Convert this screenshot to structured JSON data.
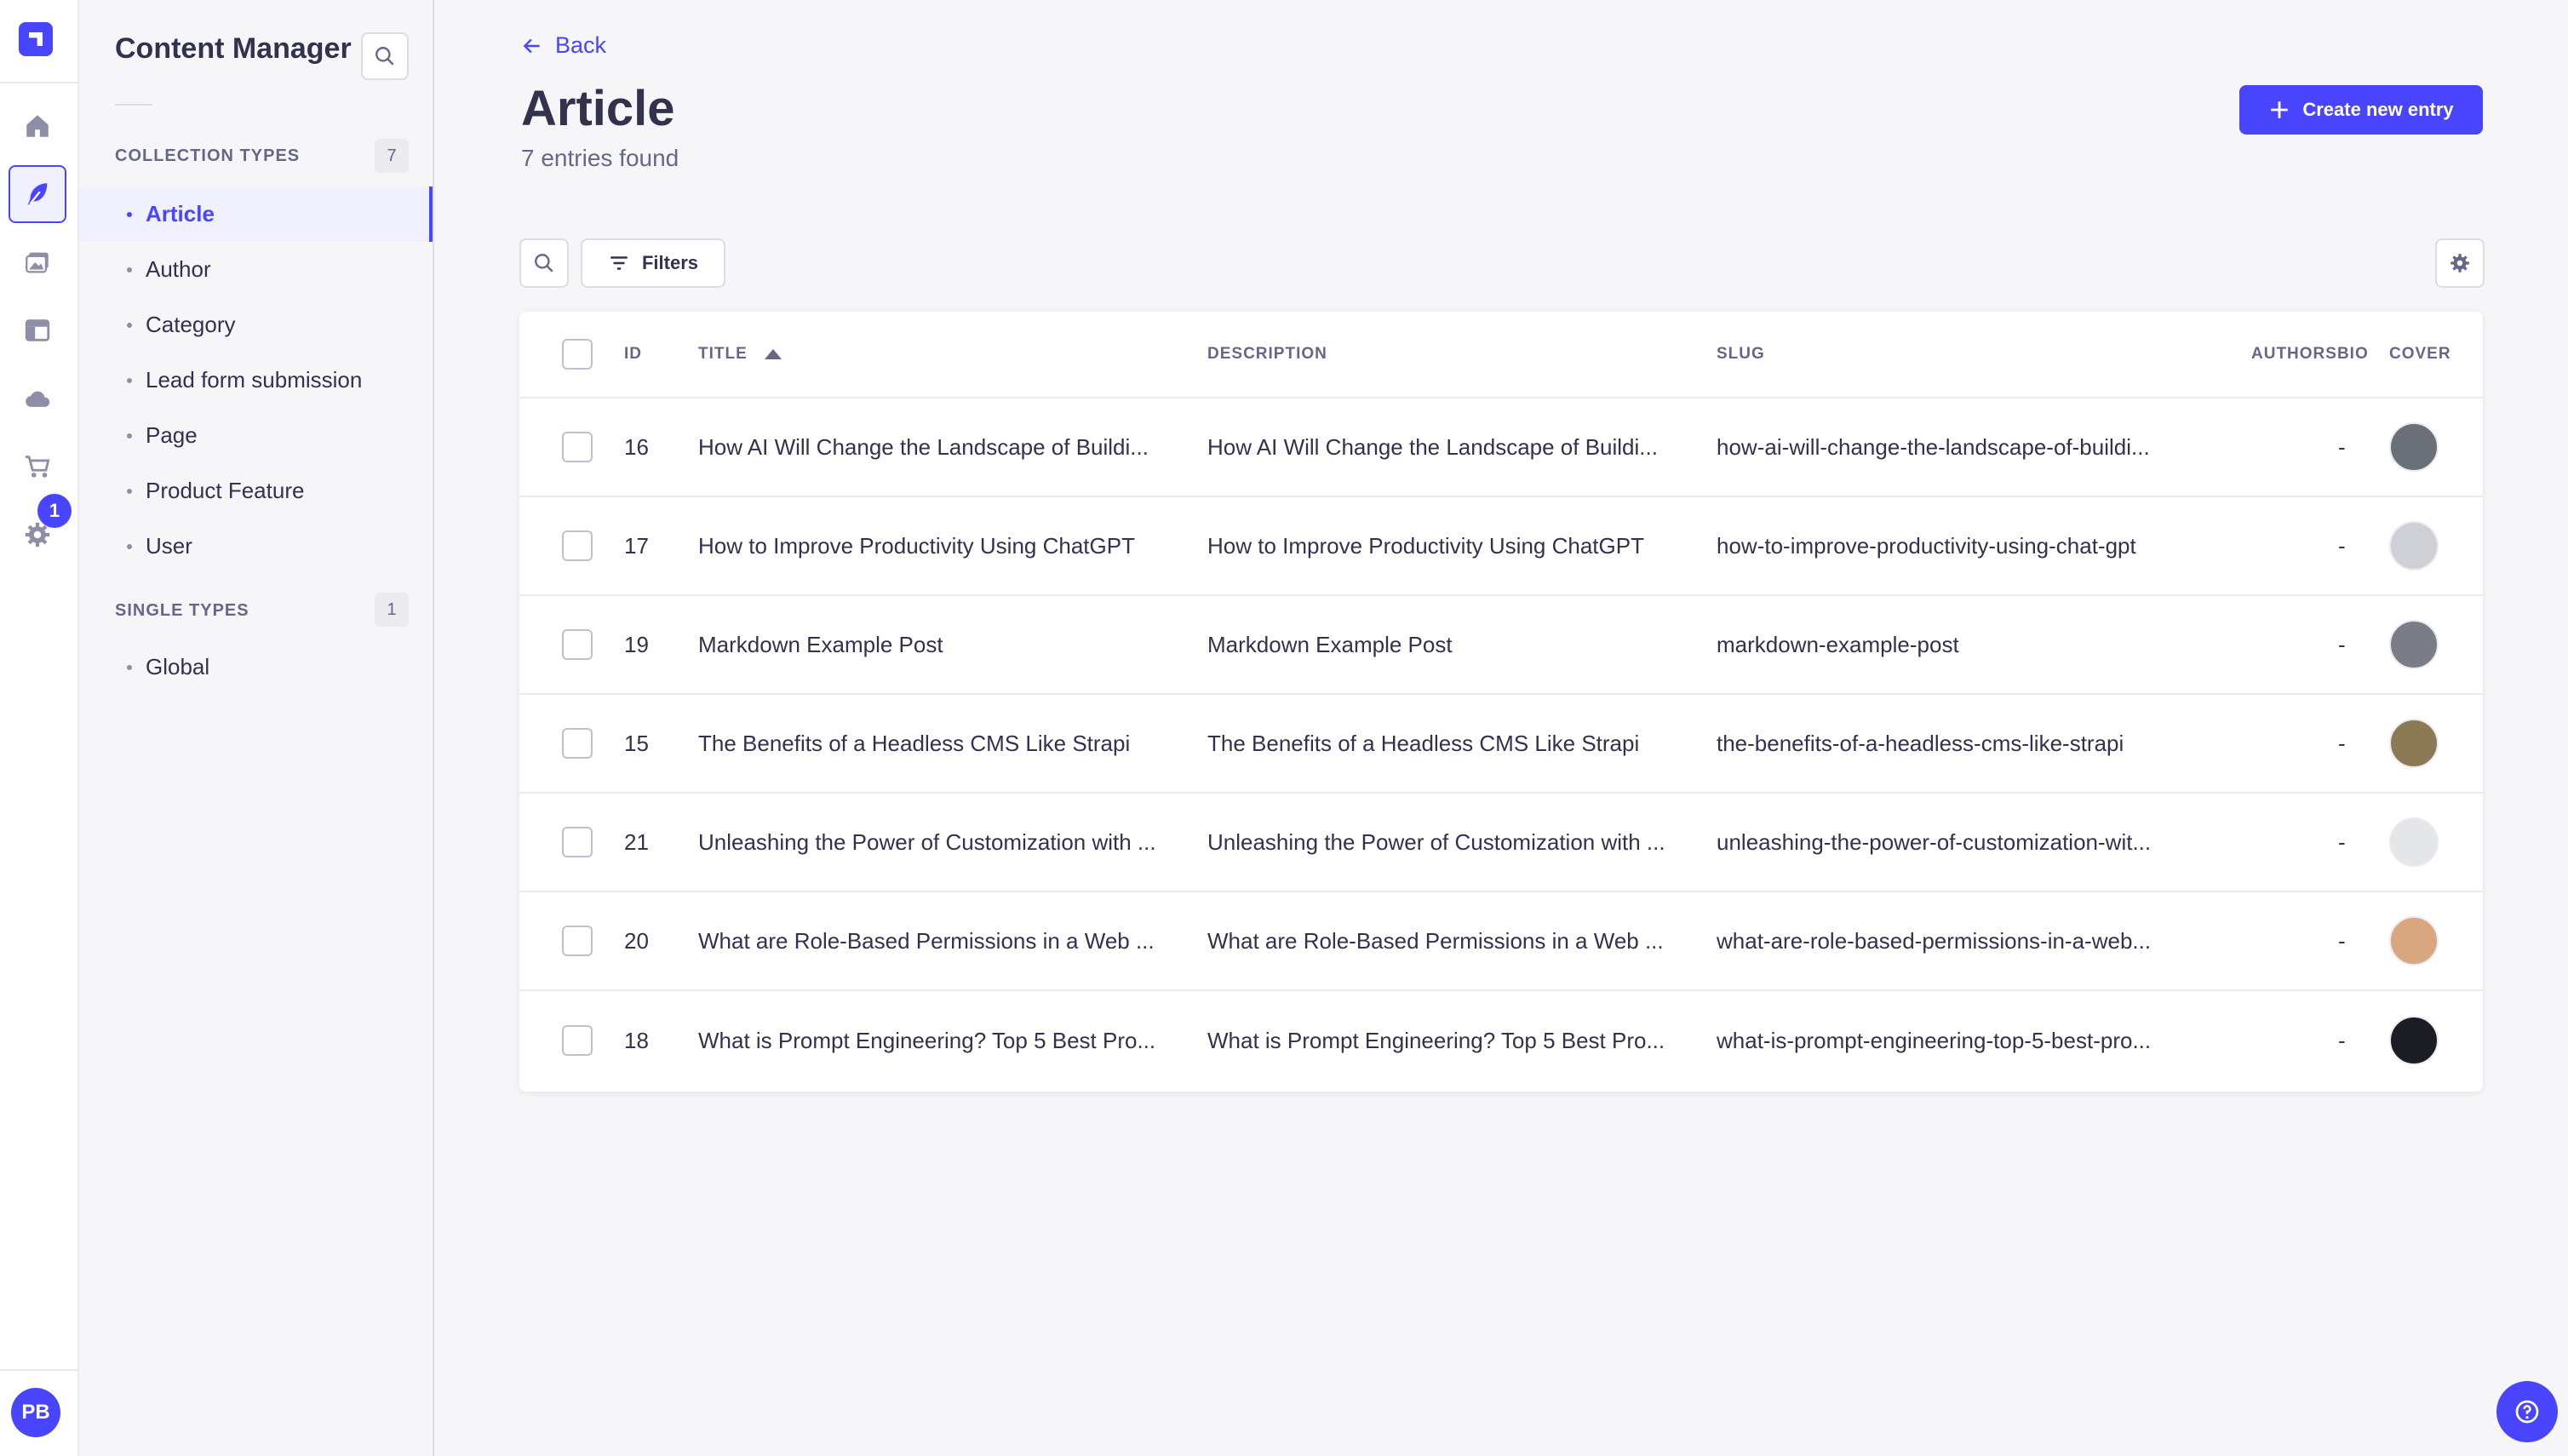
{
  "rail": {
    "notification_count": "1",
    "user_initials": "PB",
    "icons": [
      "home-icon",
      "feather-icon",
      "media-icon",
      "layout-icon",
      "cloud-icon",
      "cart-icon",
      "gear-icon"
    ]
  },
  "sidebar": {
    "title": "Content Manager",
    "collection_label": "COLLECTION TYPES",
    "collection_count": "7",
    "collection_items": [
      "Article",
      "Author",
      "Category",
      "Lead form submission",
      "Page",
      "Product Feature",
      "User"
    ],
    "single_label": "SINGLE TYPES",
    "single_count": "1",
    "single_items": [
      "Global"
    ]
  },
  "header": {
    "back_label": "Back",
    "title": "Article",
    "subtitle": "7 entries found",
    "create_label": "Create new entry"
  },
  "toolbar": {
    "filters_label": "Filters"
  },
  "table": {
    "columns": [
      "ID",
      "TITLE",
      "DESCRIPTION",
      "SLUG",
      "AUTHORSBIO",
      "COVER"
    ],
    "rows": [
      {
        "id": "16",
        "title": "How AI Will Change the Landscape of Buildi...",
        "description": "How AI Will Change the Landscape of Buildi...",
        "slug": "how-ai-will-change-the-landscape-of-buildi...",
        "authorsbio": "-",
        "cover_color": "#6b6f78"
      },
      {
        "id": "17",
        "title": "How to Improve Productivity Using ChatGPT",
        "description": "How to Improve Productivity Using ChatGPT",
        "slug": "how-to-improve-productivity-using-chat-gpt",
        "authorsbio": "-",
        "cover_color": "#cfd0d6"
      },
      {
        "id": "19",
        "title": "Markdown Example Post",
        "description": "Markdown Example Post",
        "slug": "markdown-example-post",
        "authorsbio": "-",
        "cover_color": "#7a7c88"
      },
      {
        "id": "15",
        "title": "The Benefits of a Headless CMS Like Strapi",
        "description": "The Benefits of a Headless CMS Like Strapi",
        "slug": "the-benefits-of-a-headless-cms-like-strapi",
        "authorsbio": "-",
        "cover_color": "#8c7a55"
      },
      {
        "id": "21",
        "title": "Unleashing the Power of Customization with ...",
        "description": "Unleashing the Power of Customization with ...",
        "slug": "unleashing-the-power-of-customization-wit...",
        "authorsbio": "-",
        "cover_color": "#e4e6ea"
      },
      {
        "id": "20",
        "title": "What are Role-Based Permissions in a Web ...",
        "description": "What are Role-Based Permissions in a Web ...",
        "slug": "what-are-role-based-permissions-in-a-web...",
        "authorsbio": "-",
        "cover_color": "#d9a77f"
      },
      {
        "id": "18",
        "title": "What is Prompt Engineering? Top 5 Best Pro...",
        "description": "What is Prompt Engineering? Top 5 Best Pro...",
        "slug": "what-is-prompt-engineering-top-5-best-pro...",
        "authorsbio": "-",
        "cover_color": "#1c1d24"
      }
    ]
  },
  "colors": {
    "accent": "#4945ff",
    "background": "#f6f6f9",
    "text": "#32324d",
    "muted": "#666687"
  }
}
